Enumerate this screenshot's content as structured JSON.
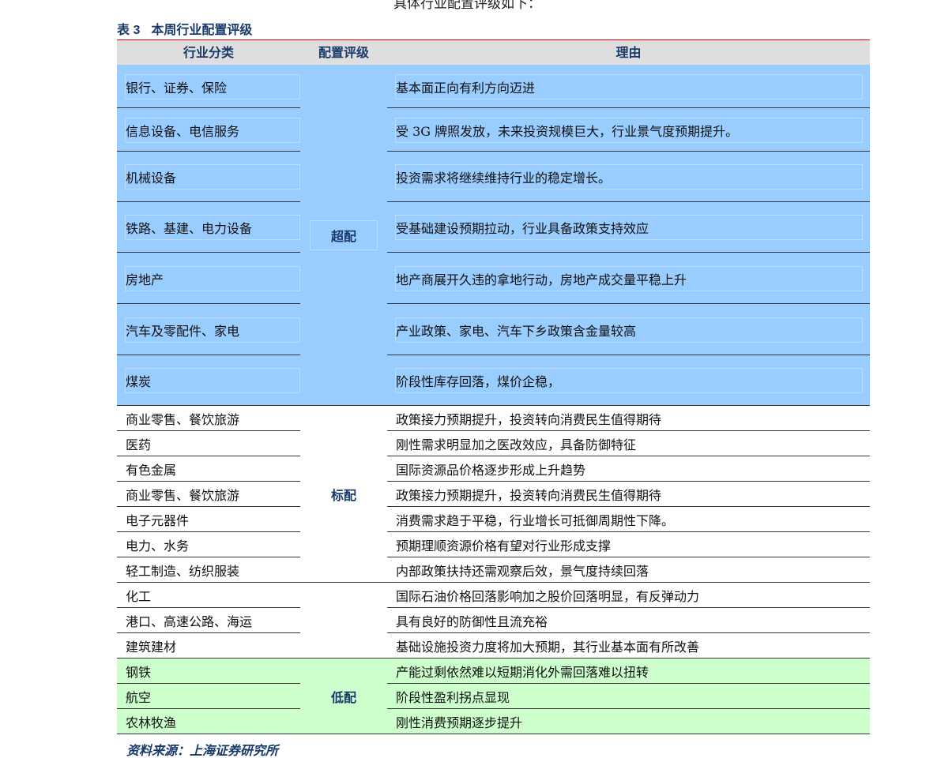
{
  "intro_text": "具体行业配置评级如下：",
  "caption": {
    "number": "表 3",
    "title": "本周行业配置评级"
  },
  "headers": [
    "行业分类",
    "配置评级",
    "理由"
  ],
  "groups": [
    {
      "rating": "超配",
      "style": "overweight",
      "rows": [
        {
          "industry": "银行、证券、保险",
          "reason": "基本面正向有利方向迈进"
        },
        {
          "industry": "信息设备、电信服务",
          "reason": "受 3G 牌照发放，未来投资规模巨大，行业景气度预期提升。"
        },
        {
          "industry": "机械设备",
          "reason": "投资需求将继续维持行业的稳定增长。"
        },
        {
          "industry": "铁路、基建、电力设备",
          "reason": "受基础建设预期拉动，行业具备政策支持效应"
        },
        {
          "industry": "房地产",
          "reason": "地产商展开久违的拿地行动，房地产成交量平稳上升"
        },
        {
          "industry": "汽车及零配件、家电",
          "reason": "产业政策、家电、汽车下乡政策含金量较高"
        },
        {
          "industry": "煤炭",
          "reason": "阶段性库存回落，煤价企稳，"
        }
      ]
    },
    {
      "rating": "标配",
      "style": "neutral",
      "rows": [
        {
          "industry": "商业零售、餐饮旅游",
          "reason": "政策接力预期提升，投资转向消费民生值得期待"
        },
        {
          "industry": "医药",
          "reason": "刚性需求明显加之医改效应，具备防御特征"
        },
        {
          "industry": "有色金属",
          "reason": "国际资源品价格逐步形成上升趋势"
        },
        {
          "industry": "商业零售、餐饮旅游",
          "reason": "政策接力预期提升，投资转向消费民生值得期待"
        },
        {
          "industry": "电子元器件",
          "reason": "消费需求趋于平稳，行业增长可抵御周期性下降。"
        },
        {
          "industry": "电力、水务",
          "reason": "预期理顺资源价格有望对行业形成支撑"
        },
        {
          "industry": "轻工制造、纺织服装",
          "reason": "内部政策扶持还需观察后效，景气度持续回落"
        }
      ]
    },
    {
      "rating": "",
      "style": "neutral",
      "rows": [
        {
          "industry": "化工",
          "reason": "国际石油价格回落影响加之股价回落明显，有反弹动力"
        },
        {
          "industry": "港口、高速公路、海运",
          "reason": "具有良好的防御性且流充裕"
        },
        {
          "industry": "建筑建材",
          "reason": "基础设施投资力度将加大预期，其行业基本面有所改善"
        }
      ]
    },
    {
      "rating": "低配",
      "style": "underweight",
      "rows": [
        {
          "industry": "钢铁",
          "reason": "产能过剩依然难以短期消化外需回落难以扭转"
        },
        {
          "industry": "航空",
          "reason": "阶段性盈利拐点显现"
        },
        {
          "industry": "农林牧渔",
          "reason": "刚性消费预期逐步提升"
        }
      ]
    }
  ],
  "source": "资料来源：上海证券研究所",
  "colors": {
    "overweight": "#99ccff",
    "underweight": "#ccffcc",
    "header": "#dedede",
    "rule": "#e00000",
    "title": "#1a3a6a"
  }
}
